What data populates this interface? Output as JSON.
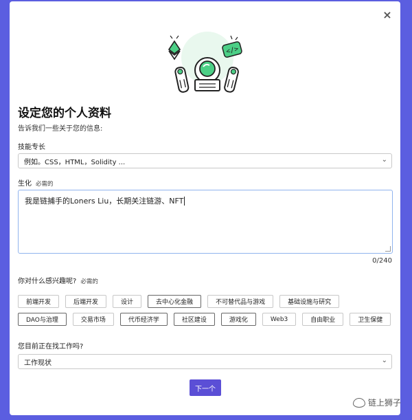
{
  "dialog": {
    "close_glyph": "×",
    "title": "设定您的个人资料",
    "subtitle": "告诉我们一些关于您的信息:"
  },
  "skills": {
    "label": "技能专长",
    "placeholder": "例如。CSS，HTML，Solidity ..."
  },
  "bio": {
    "label": "生化",
    "required": "必需的",
    "value": "我是链捕手的Loners Liu，长期关注链游、NFT",
    "counter": "0/240"
  },
  "interests": {
    "label": "你对什么感兴趣呢?",
    "required": "必需的",
    "chips": [
      {
        "label": "前端开发",
        "selected": false
      },
      {
        "label": "后端开发",
        "selected": false
      },
      {
        "label": "设计",
        "selected": false
      },
      {
        "label": "去中心化金融",
        "selected": true
      },
      {
        "label": "不可替代品与游戏",
        "selected": false
      },
      {
        "label": "基础设施与研究",
        "selected": false
      },
      {
        "label": "DAO与治理",
        "selected": true
      },
      {
        "label": "交易市场",
        "selected": false
      },
      {
        "label": "代币经济学",
        "selected": true
      },
      {
        "label": "社区建设",
        "selected": true
      },
      {
        "label": "游戏化",
        "selected": true
      },
      {
        "label": "Web3",
        "selected": false
      },
      {
        "label": "自由职业",
        "selected": false
      },
      {
        "label": "卫生保健",
        "selected": false
      }
    ]
  },
  "job": {
    "label": "您目前正在找工作吗?",
    "selected": "工作现状"
  },
  "next_label": "下一个",
  "watermark": "链上狮子",
  "colors": {
    "background": "#5b5ee0",
    "primary_button": "#5b4fd6",
    "focus_border": "#8fb3ee"
  }
}
